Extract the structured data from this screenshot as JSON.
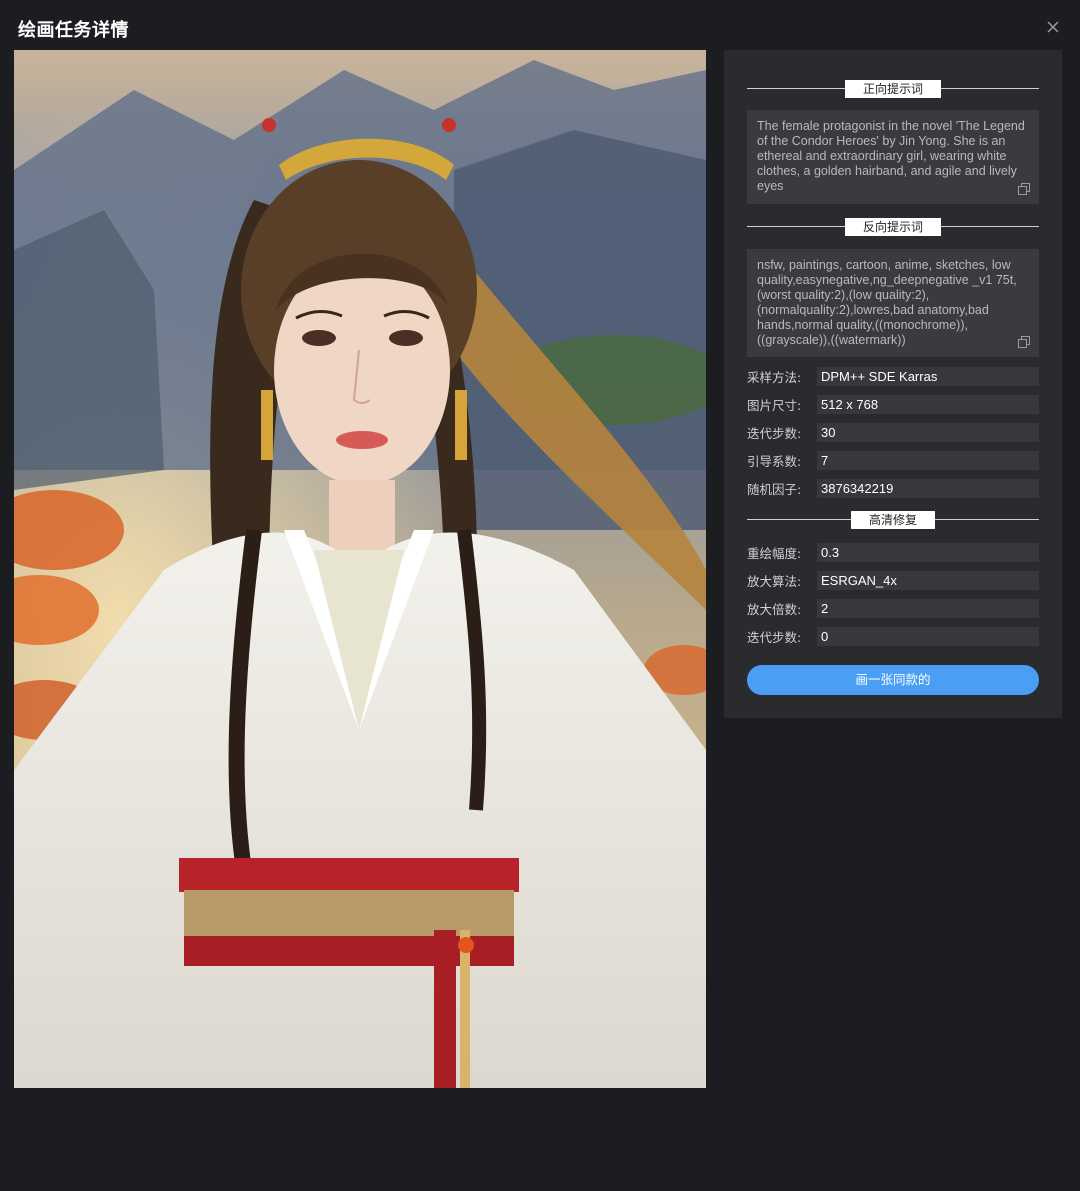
{
  "dialog": {
    "title": "绘画任务详情",
    "close_icon": "close-icon"
  },
  "artwork": {
    "kind": "AI-generated portrait: young woman in white hanfu with golden hairband and red sash, mountain landscape with orange autumn trees"
  },
  "positive_prompt": {
    "heading": "正向提示词",
    "text": "The female protagonist in the novel 'The Legend of the Condor Heroes' by Jin Yong. She is an ethereal and extraordinary girl, wearing white clothes, a golden hairband, and agile and lively eyes",
    "copy_icon": "copy-icon"
  },
  "negative_prompt": {
    "heading": "反向提示词",
    "text": "nsfw, paintings, cartoon, anime, sketches, low quality,easynegative,ng_deepnegative _v1 75t,(worst quality:2),(low quality:2),(normalquality:2),lowres,bad anatomy,bad hands,normal quality,((monochrome)),((grayscale)),((watermark))",
    "copy_icon": "copy-icon"
  },
  "params": [
    {
      "label": "采样方法:",
      "value": "DPM++ SDE Karras"
    },
    {
      "label": "图片尺寸:",
      "value": "512 x 768"
    },
    {
      "label": "迭代步数:",
      "value": "30"
    },
    {
      "label": "引导系数:",
      "value": "7"
    },
    {
      "label": "随机因子:",
      "value": "3876342219"
    }
  ],
  "hires": {
    "heading": "高清修复",
    "params": [
      {
        "label": "重绘幅度:",
        "value": "0.3"
      },
      {
        "label": "放大算法:",
        "value": "ESRGAN_4x"
      },
      {
        "label": "放大倍数:",
        "value": "2"
      },
      {
        "label": "迭代步数:",
        "value": "0"
      }
    ]
  },
  "cta_label": "画一张同款的",
  "colors": {
    "background": "#1c1d21",
    "panel": "#2a2b2f",
    "field": "#37383c",
    "accent": "#4a9ff5"
  }
}
